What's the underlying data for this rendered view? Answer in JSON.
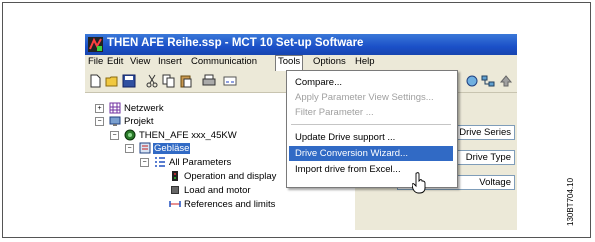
{
  "window": {
    "title": "THEN AFE Reihe.ssp - MCT 10 Set-up Software"
  },
  "menubar": {
    "items": [
      "File",
      "Edit",
      "View",
      "Insert",
      "Communication",
      "Tools",
      "Options",
      "Help"
    ],
    "active": "Tools"
  },
  "toolbar": {
    "icons": [
      "new-file-icon",
      "open-folder-icon",
      "save-icon",
      "cut-icon",
      "copy-icon",
      "paste-icon",
      "print-icon",
      "parameter-icon"
    ]
  },
  "tools_menu": {
    "items": [
      {
        "label": "Compare...",
        "enabled": true
      },
      {
        "label": "Apply Parameter View Settings...",
        "enabled": false
      },
      {
        "label": "Filter Parameter ...",
        "enabled": false
      },
      {
        "label": "Update Drive support ...",
        "enabled": true
      },
      {
        "label": "Drive Conversion Wizard...",
        "enabled": true,
        "highlighted": true
      },
      {
        "label": "Import drive from Excel...",
        "enabled": true
      }
    ]
  },
  "tree": {
    "nodes": [
      {
        "label": "Netzwerk",
        "icon": "network-icon"
      },
      {
        "label": "Projekt",
        "icon": "project-icon"
      },
      {
        "label": "THEN_AFE xxx_45KW",
        "icon": "drive-icon"
      },
      {
        "label": "Gebläse",
        "icon": "drive-unit-icon",
        "selected": true
      },
      {
        "label": "All Parameters",
        "icon": "parameter-list-icon"
      },
      {
        "label": "Operation and display",
        "icon": "display-icon"
      },
      {
        "label": "Load and motor",
        "icon": "motor-icon"
      },
      {
        "label": "References and limits",
        "icon": "references-icon"
      }
    ]
  },
  "right_panel": {
    "fields": [
      "Drive Series",
      "Drive Type",
      "Voltage"
    ]
  },
  "figure_id": "130BT704.10",
  "colors": {
    "titlebar": "#1b50c8",
    "highlight": "#316ac5",
    "panel": "#ece9d8"
  }
}
